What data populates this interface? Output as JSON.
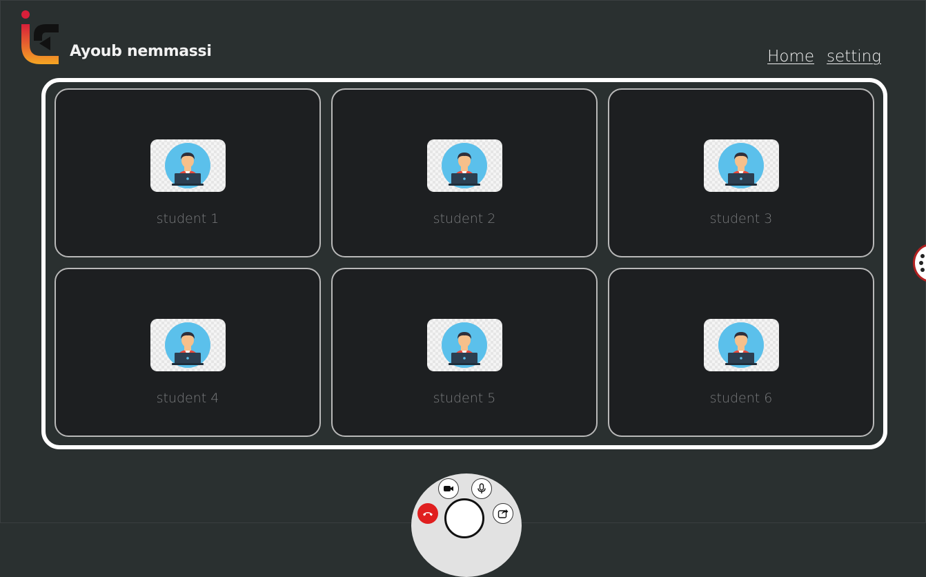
{
  "header": {
    "username": "Ayoub nemmassi",
    "nav": {
      "home_label": "Home",
      "setting_label": "setting"
    }
  },
  "students": [
    {
      "label": "student 1"
    },
    {
      "label": "student 2"
    },
    {
      "label": "student 3"
    },
    {
      "label": "student 4"
    },
    {
      "label": "student 5"
    },
    {
      "label": "student 6"
    }
  ],
  "controls": {
    "icons": [
      "video-camera-icon",
      "microphone-icon",
      "hang-up-icon",
      "share-screen-icon"
    ]
  },
  "colors": {
    "background": "#2a3030",
    "tile_background": "#1d1f21",
    "tile_border": "#b9b9b9",
    "grid_border": "#ffffff",
    "hangup": "#e01f1f",
    "logo_red": "#d81f3a",
    "logo_orange": "#f5a623"
  }
}
